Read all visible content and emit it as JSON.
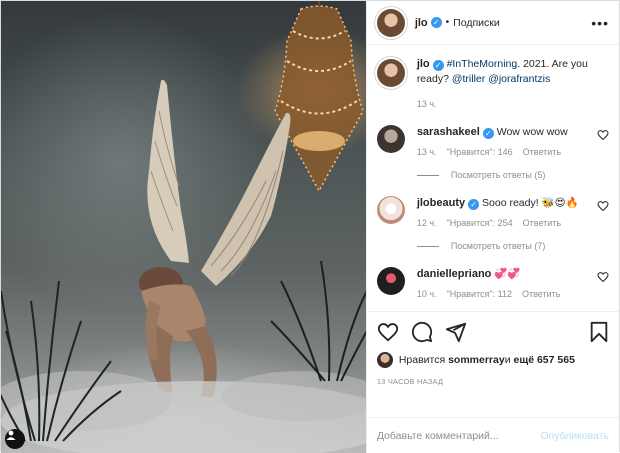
{
  "header": {
    "username": "jlo",
    "separator": "•",
    "follow_label": "Подписки",
    "more_icon": "more-horizontal-icon"
  },
  "caption": {
    "username": "jlo",
    "hashtag": "#InTheMorning",
    "text": ". 2021. Are you ready? ",
    "mention1": "@triller",
    "mention2": "@jorafrantzis",
    "time": "13 ч."
  },
  "comments": [
    {
      "username": "sarashakeel",
      "text": "Wow wow wow",
      "time": "13 ч.",
      "likes": "\"Нравится\": 146",
      "reply": "Ответить",
      "view_replies": "Посмотреть ответы (5)",
      "avatar_color": "#c9c2bd"
    },
    {
      "username": "jlobeauty",
      "text": "Sooo ready! 🐝😍🔥",
      "time": "12 ч.",
      "likes": "\"Нравится\": 254",
      "reply": "Ответить",
      "view_replies": "Посмотреть ответы (7)",
      "avatar_color": "#f1e2dc"
    },
    {
      "username": "daniellepriano",
      "text": "💞💞",
      "time": "10 ч.",
      "likes": "\"Нравится\": 112",
      "reply": "Ответить",
      "avatar_color": "#2b2b2b"
    }
  ],
  "actions": {
    "likes_prefix": "Нравится ",
    "likes_user": "sommerray",
    "likes_middle": " и ",
    "likes_count": "ещё 657 565",
    "post_time": "13 ЧАСОВ НАЗАД"
  },
  "add_comment": {
    "placeholder": "Добавьте комментарий...",
    "publish_label": "Опубликовать"
  },
  "colors": {
    "verified": "#3897f0",
    "link": "#00376b",
    "muted": "#8e8e8e",
    "publish_disabled": "#b2dffc"
  }
}
